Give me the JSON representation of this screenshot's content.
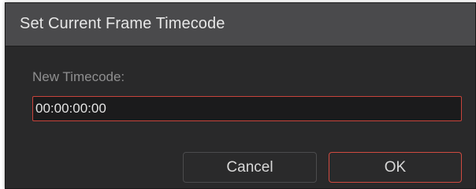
{
  "dialog": {
    "title": "Set Current Frame Timecode",
    "field_label": "New Timecode:",
    "timecode_value": "00:00:00:00",
    "buttons": {
      "cancel": "Cancel",
      "ok": "OK"
    }
  },
  "colors": {
    "accent_border": "#c8433b",
    "titlebar": "#4a4a4c",
    "body": "#29292a"
  }
}
